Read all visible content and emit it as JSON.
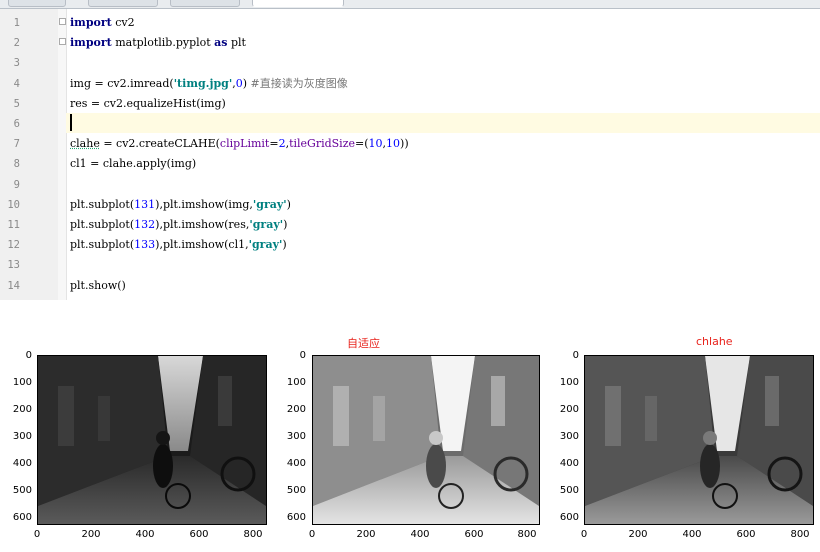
{
  "editor": {
    "lines": [
      {
        "num": "1"
      },
      {
        "num": "2"
      },
      {
        "num": "3"
      },
      {
        "num": "4"
      },
      {
        "num": "5"
      },
      {
        "num": "6"
      },
      {
        "num": "7"
      },
      {
        "num": "8"
      },
      {
        "num": "9"
      },
      {
        "num": "10"
      },
      {
        "num": "11"
      },
      {
        "num": "12"
      },
      {
        "num": "13"
      },
      {
        "num": "14"
      }
    ],
    "code": {
      "l1_kw": "import",
      "l1_rest": " cv2",
      "l2_kw1": "import",
      "l2_mid": " matplotlib.pyplot ",
      "l2_kw2": "as",
      "l2_end": " plt",
      "l4_a": "img = cv2.imread(",
      "l4_str": "'timg.jpg'",
      "l4_b": ",",
      "l4_num": "0",
      "l4_c": ") ",
      "l4_cmt": "#直接读为灰度图像",
      "l5": "res = cv2.equalizeHist(img)",
      "l7_a": "clahe",
      "l7_b": " = cv2.createCLAHE(",
      "l7_p1": "clipLimit",
      "l7_c": "=",
      "l7_n1": "2",
      "l7_d": ",",
      "l7_p2": "tileGridSize",
      "l7_e": "=(",
      "l7_n2": "10",
      "l7_f": ",",
      "l7_n3": "10",
      "l7_g": "))",
      "l8": "cl1 = clahe.apply(img)",
      "l10_a": "plt.subplot(",
      "l10_n": "131",
      "l10_b": "),plt.imshow(img,",
      "l10_s": "'gray'",
      "l10_c": ")",
      "l11_a": "plt.subplot(",
      "l11_n": "132",
      "l11_b": "),plt.imshow(res,",
      "l11_s": "'gray'",
      "l11_c": ")",
      "l12_a": "plt.subplot(",
      "l12_n": "133",
      "l12_b": "),plt.imshow(cl1,",
      "l12_s": "'gray'",
      "l12_c": ")",
      "l14": "plt.show()"
    }
  },
  "figure": {
    "panel_titles": [
      "",
      "自适应",
      "chlahe"
    ],
    "y_ticks": [
      "0",
      "100",
      "200",
      "300",
      "400",
      "500",
      "600"
    ],
    "x_ticks": [
      "0",
      "200",
      "400",
      "600",
      "800"
    ]
  },
  "colors": {
    "title_red": "#e8231c",
    "keyword": "#000080",
    "string": "#008080"
  }
}
